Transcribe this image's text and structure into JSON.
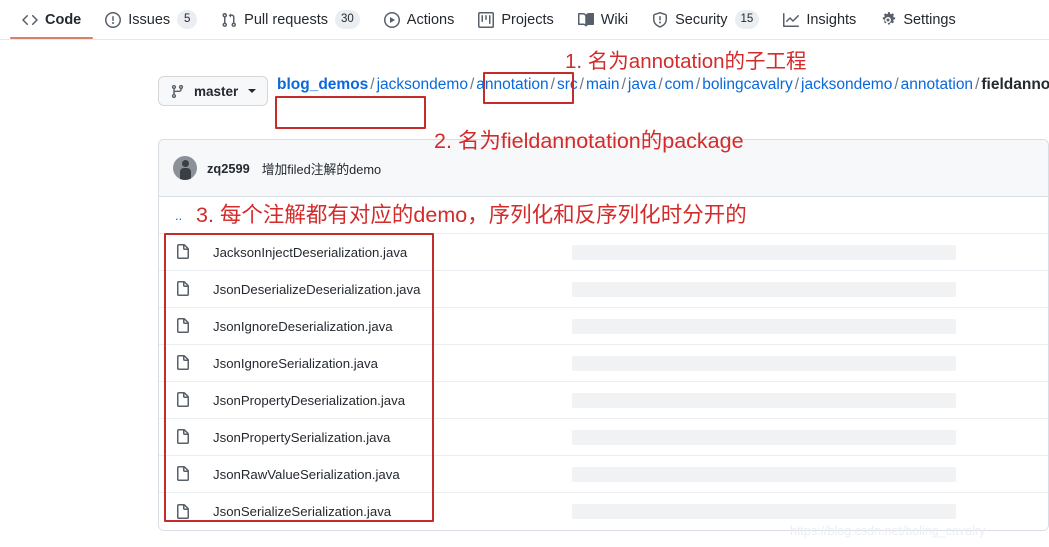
{
  "nav": {
    "tabs": [
      {
        "label": "Code",
        "icon": "code-icon",
        "count": null,
        "active": true
      },
      {
        "label": "Issues",
        "icon": "issue-opened-icon",
        "count": "5",
        "active": false
      },
      {
        "label": "Pull requests",
        "icon": "git-pull-request-icon",
        "count": "30",
        "active": false
      },
      {
        "label": "Actions",
        "icon": "play-icon",
        "count": null,
        "active": false
      },
      {
        "label": "Projects",
        "icon": "project-icon",
        "count": null,
        "active": false
      },
      {
        "label": "Wiki",
        "icon": "book-icon",
        "count": null,
        "active": false
      },
      {
        "label": "Security",
        "icon": "shield-icon",
        "count": "15",
        "active": false
      },
      {
        "label": "Insights",
        "icon": "graph-icon",
        "count": null,
        "active": false
      },
      {
        "label": "Settings",
        "icon": "gear-icon",
        "count": null,
        "active": false
      }
    ]
  },
  "branch": {
    "name": "master",
    "icon": "git-branch-icon",
    "caret": "chevron-down-icon"
  },
  "breadcrumb": {
    "repo": "blog_demos",
    "segments": [
      "jacksondemo",
      "annotation",
      "src",
      "main",
      "java",
      "com",
      "bolingcavalry",
      "jacksondemo",
      "annotation"
    ],
    "current": "fieldannotation",
    "separator": "/"
  },
  "commit": {
    "author": "zq2599",
    "message": "增加filed注解的demo",
    "avatar": "user-avatar"
  },
  "files": {
    "parent_label": "..",
    "items": [
      {
        "name": "JacksonInjectDeserialization.java",
        "icon": "file-icon"
      },
      {
        "name": "JsonDeserializeDeserialization.java",
        "icon": "file-icon"
      },
      {
        "name": "JsonIgnoreDeserialization.java",
        "icon": "file-icon"
      },
      {
        "name": "JsonIgnoreSerialization.java",
        "icon": "file-icon"
      },
      {
        "name": "JsonPropertyDeserialization.java",
        "icon": "file-icon"
      },
      {
        "name": "JsonPropertySerialization.java",
        "icon": "file-icon"
      },
      {
        "name": "JsonRawValueSerialization.java",
        "icon": "file-icon"
      },
      {
        "name": "JsonSerializeSerialization.java",
        "icon": "file-icon"
      }
    ]
  },
  "annotations": [
    {
      "id": "annotation-1",
      "text": "1. 名为annotation的子工程"
    },
    {
      "id": "annotation-2",
      "text": "2. 名为fieldannotation的package"
    },
    {
      "id": "annotation-3",
      "text": "3. 每个注解都有对应的demo，序列化和反序列化时分开的"
    }
  ],
  "watermark": {
    "text": "https://blog.csdn.net/boling_cavalry"
  },
  "colors": {
    "link": "#0969da",
    "annotation_red": "#d32b2b",
    "box_red": "#c42b2b",
    "active_tab_underline": "#d9806c",
    "placeholder_bar": "#f1f2f4",
    "commit_bar_bg": "#f6f8fa"
  }
}
